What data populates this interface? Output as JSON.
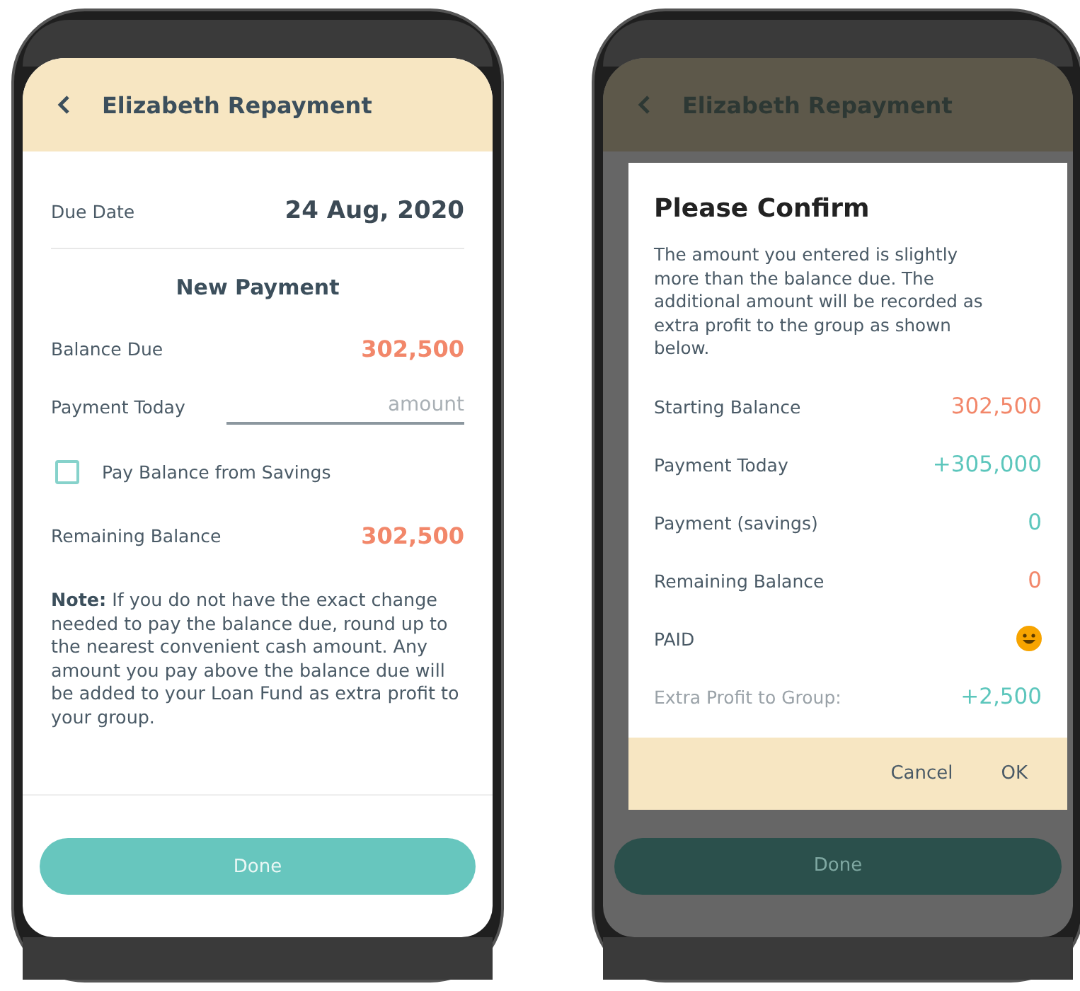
{
  "form_screen": {
    "header": {
      "title": "Elizabeth Repayment"
    },
    "due_date": {
      "label": "Due Date",
      "value": "24 Aug, 2020"
    },
    "section_title": "New Payment",
    "balance_due": {
      "label": "Balance Due",
      "value": "302,500"
    },
    "payment_today": {
      "label": "Payment Today",
      "placeholder": "amount"
    },
    "savings_checkbox": {
      "label": "Pay Balance from Savings",
      "checked": false
    },
    "remaining_balance": {
      "label": "Remaining Balance",
      "value": "302,500"
    },
    "note": "**Note:** If you do not have the exact change needed to pay the balance due, round up to the nearest convenient cash amount. Any amount you pay above the balance due will be added to your Loan Fund as extra profit to your group.",
    "done_button": "Done"
  },
  "confirm_screen": {
    "header": {
      "title": "Elizabeth Repayment"
    },
    "dialog": {
      "title": "Please Confirm",
      "message": "The amount you entered is slightly more than the balance due. The additional amount will be recorded as extra profit to the group as shown below.",
      "rows": [
        {
          "kind": "amount",
          "label": "Starting Balance",
          "value": "302,500",
          "color": "#f2876a"
        },
        {
          "kind": "amount",
          "label": "Payment Today",
          "value": "+305,000",
          "color": "#5cc6bc"
        },
        {
          "kind": "amount",
          "label": "Payment (savings)",
          "value": "0",
          "color": "#5cc6bc"
        },
        {
          "kind": "amount",
          "label": "Remaining Balance",
          "value": "0",
          "color": "#f2876a"
        },
        {
          "kind": "status",
          "label": "PAID"
        },
        {
          "kind": "summary",
          "label": "Extra Profit to Group:",
          "value": "+2,500",
          "color": "#5cc6bc"
        }
      ],
      "buttons": [
        "Cancel",
        "OK"
      ]
    },
    "done_button": "Done"
  }
}
